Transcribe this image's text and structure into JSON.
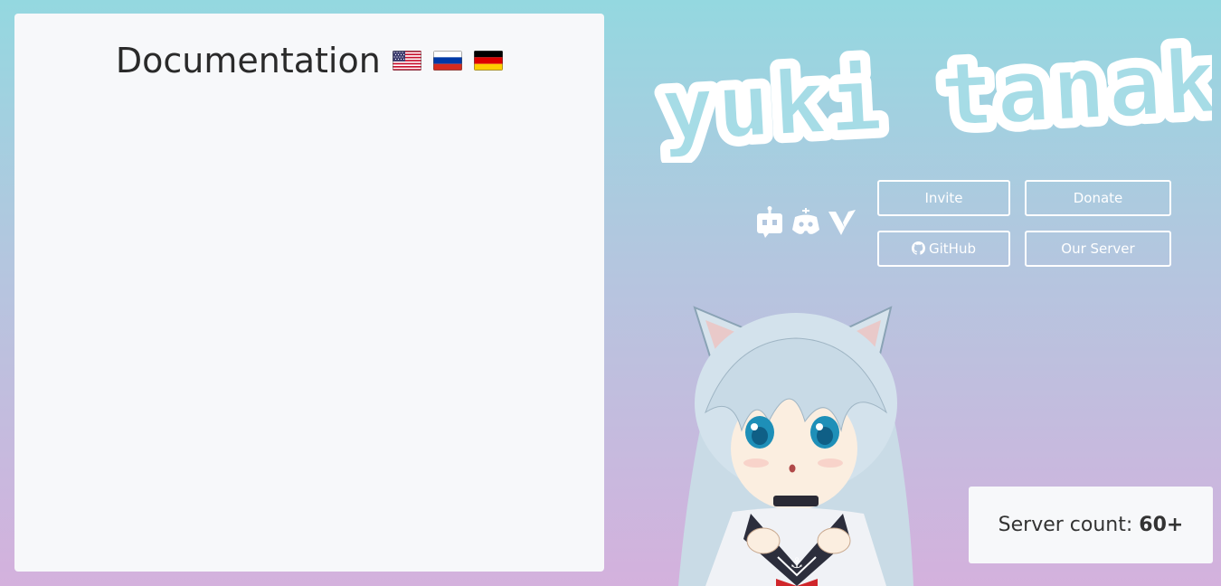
{
  "documentation": {
    "title": "Documentation",
    "flags": [
      {
        "name": "us-flag-icon",
        "language": "English"
      },
      {
        "name": "ru-flag-icon",
        "language": "Russian"
      },
      {
        "name": "de-flag-icon",
        "language": "German"
      }
    ]
  },
  "logo": {
    "text": "yuki tanaka"
  },
  "icons": [
    "bot-list-icon",
    "discord-bots-icon",
    "vote-icon"
  ],
  "buttons": {
    "invite": "Invite",
    "donate": "Donate",
    "github": "GitHub",
    "server": "Our Server"
  },
  "stats": {
    "server_count_label": "Server count:",
    "server_count_value": "60+"
  },
  "colors": {
    "gradient_top": "#94d8e0",
    "gradient_bottom": "#d4b1dd",
    "panel": "#f7f8fa",
    "button_border": "#ffffff"
  }
}
